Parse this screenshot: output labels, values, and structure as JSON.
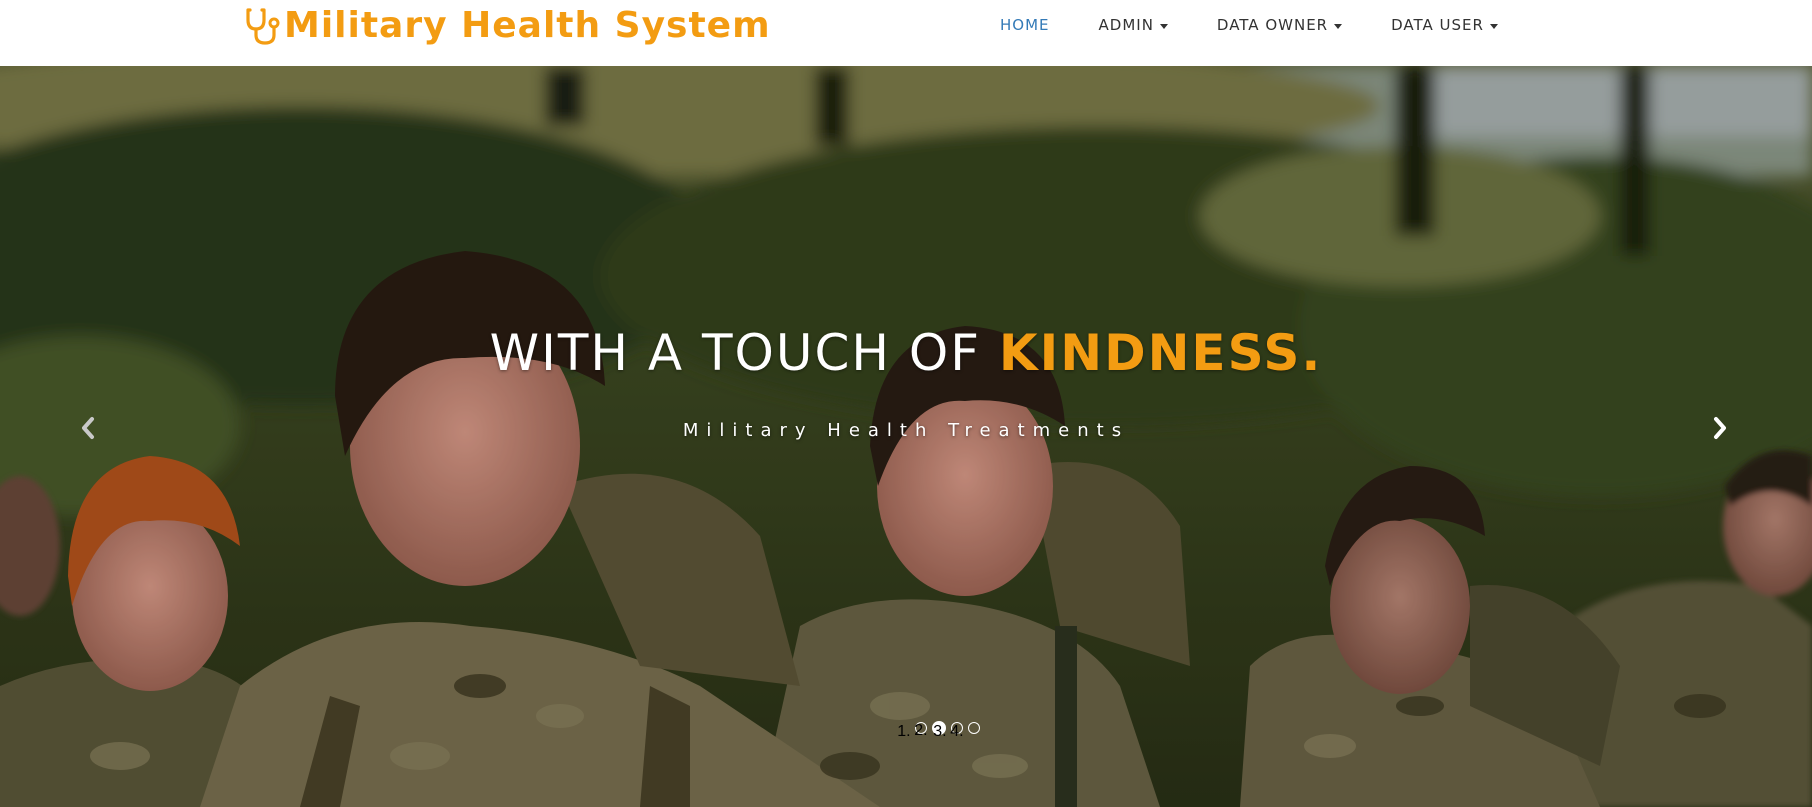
{
  "brand": {
    "name": "Military Health System",
    "icon": "stethoscope-icon",
    "color": "#f39c12"
  },
  "nav": {
    "items": [
      {
        "label": "HOME",
        "active": true,
        "dropdown": false
      },
      {
        "label": "ADMIN",
        "active": false,
        "dropdown": true
      },
      {
        "label": "DATA OWNER",
        "active": false,
        "dropdown": true
      },
      {
        "label": "DATA USER",
        "active": false,
        "dropdown": true
      }
    ],
    "active_color": "#337ab7"
  },
  "hero": {
    "headline_light": "WITH A TOUCH OF",
    "headline_accent": "KINDNESS.",
    "subline": "Military Health Treatments",
    "accent_color": "#f39c12",
    "prev_icon": "chevron-left-icon",
    "next_icon": "chevron-right-icon",
    "slide_count": 4,
    "active_slide": 2
  }
}
